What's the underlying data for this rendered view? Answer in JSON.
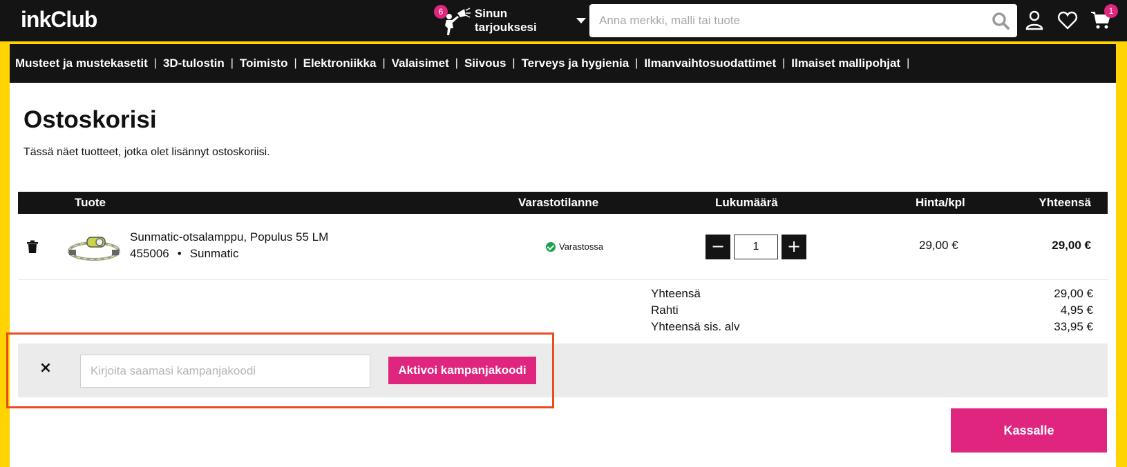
{
  "header": {
    "logo": "inkClub",
    "offers_badge": "6",
    "offers_label": "Sinun tarjouksesi",
    "search_placeholder": "Anna merkki, malli tai tuote",
    "cart_badge": "1"
  },
  "categories": [
    "Musteet ja mustekasetit",
    "3D-tulostin",
    "Toimisto",
    "Elektroniikka",
    "Valaisimet",
    "Siivous",
    "Terveys ja hygienia",
    "Ilmanvaihtosuodattimet",
    "Ilmaiset mallipohjat"
  ],
  "category_separator": "|",
  "page": {
    "title": "Ostoskorisi",
    "subtitle": "Tässä näet tuotteet, jotka olet lisännyt ostoskoriisi."
  },
  "table": {
    "headers": {
      "product": "Tuote",
      "stock": "Varastotilanne",
      "quantity": "Lukumäärä",
      "unit_price": "Hinta/kpl",
      "total": "Yhteensä"
    }
  },
  "item": {
    "name": "Sunmatic-otsalamppu, Populus 55 LM",
    "sku": "455006",
    "meta_dot": "•",
    "brand": "Sunmatic",
    "stock": "Varastossa",
    "quantity": "1",
    "qty_minus": "−",
    "qty_plus": "+",
    "unit_price": "29,00 €",
    "total": "29,00 €"
  },
  "summary": {
    "subtotal_label": "Yhteensä",
    "subtotal_value": "29,00 €",
    "shipping_label": "Rahti",
    "shipping_value": "4,95 €",
    "grand_label": "Yhteensä sis. alv",
    "grand_value": "33,95 €"
  },
  "promo": {
    "close": "×",
    "placeholder": "Kirjoita saamasi kampanjakoodi",
    "button": "Aktivoi kampanjakoodi"
  },
  "checkout": {
    "label": "Kassalle"
  },
  "colors": {
    "brand_pink": "#e0257f",
    "frame_yellow": "#ffd400",
    "header_black": "#141414",
    "highlight": "#ea4c1e",
    "stock_green": "#19a34a"
  }
}
